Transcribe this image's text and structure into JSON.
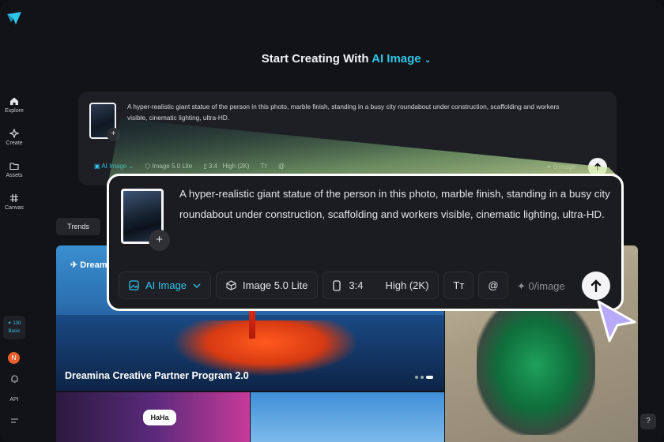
{
  "sidebar": {
    "items": [
      {
        "label": "Explore",
        "icon": "home-icon"
      },
      {
        "label": "Create",
        "icon": "sparkle-icon"
      },
      {
        "label": "Assets",
        "icon": "folder-icon"
      },
      {
        "label": "Canvas",
        "icon": "canvas-icon"
      }
    ],
    "credits_value": "✦ 130",
    "credits_plan": "Basic",
    "avatar_initial": "N",
    "api_label": "API"
  },
  "header": {
    "prefix": "Start Creating With ",
    "mode": "AI Image",
    "chevron": "⌄"
  },
  "prompt": {
    "text": "A hyper-realistic giant statue of the person in this photo, marble finish, standing in a busy city roundabout under construction, scaffolding and workers visible, cinematic lighting, ultra-HD.",
    "add_symbol": "+",
    "toolbar": {
      "mode": "AI Image",
      "model": "Image 5.0 Lite",
      "ratio": "3:4",
      "quality": "High (2K)",
      "text_style_symbol": "Tт",
      "mention_symbol": "@",
      "cost": "✦ 0/image"
    }
  },
  "small_card": {
    "model": "Image 5.0 Lite",
    "cost": "✦ 0/image"
  },
  "tabs": {
    "trends": "Trends"
  },
  "gallery": {
    "banner_brand": "Dreamina",
    "banner_title": "Dreamina Creative Partner Program 2.0",
    "tile_caption": "HaHa"
  },
  "help_symbol": "?",
  "colors": {
    "accent": "#2fc4ea",
    "background": "#121316",
    "card": "#1a1c20"
  }
}
